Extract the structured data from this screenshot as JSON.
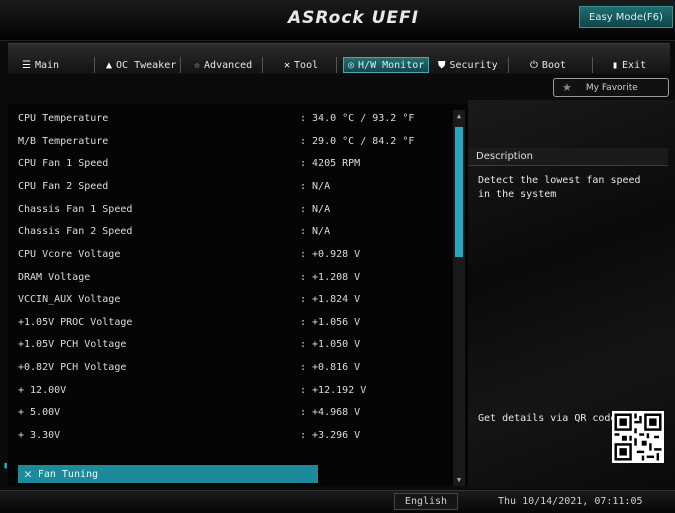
{
  "header": {
    "brand": "ASRock UEFI",
    "easy_mode": "Easy Mode(F6)"
  },
  "tabs": [
    {
      "label": "Main",
      "icon": "list-icon"
    },
    {
      "label": "OC Tweaker",
      "icon": "rocket-icon"
    },
    {
      "label": "Advanced",
      "icon": "star-icon"
    },
    {
      "label": "Tool",
      "icon": "tools-icon"
    },
    {
      "label": "H/W Monitor",
      "icon": "monitor-icon",
      "active": true
    },
    {
      "label": "Security",
      "icon": "shield-icon"
    },
    {
      "label": "Boot",
      "icon": "power-icon"
    },
    {
      "label": "Exit",
      "icon": "exit-icon"
    }
  ],
  "favorite": {
    "label": "My Favorite",
    "icon": "star-icon"
  },
  "monitor": {
    "rows": [
      {
        "label": "CPU Temperature",
        "value": ": 34.0 °C /  93.2 °F"
      },
      {
        "label": "M/B Temperature",
        "value": ": 29.0 °C /  84.2 °F"
      },
      {
        "label": "CPU Fan 1 Speed",
        "value": ": 4205 RPM"
      },
      {
        "label": "CPU Fan 2 Speed",
        "value": ": N/A"
      },
      {
        "label": "Chassis Fan 1 Speed",
        "value": ": N/A"
      },
      {
        "label": "Chassis Fan 2 Speed",
        "value": ": N/A"
      },
      {
        "label": "CPU Vcore Voltage",
        "value": ": +0.928 V"
      },
      {
        "label": "DRAM Voltage",
        "value": ": +1.208 V"
      },
      {
        "label": "VCCIN_AUX Voltage",
        "value": ": +1.824 V"
      },
      {
        "label": "+1.05V PROC Voltage",
        "value": ": +1.056 V"
      },
      {
        "label": "+1.05V PCH Voltage",
        "value": ": +1.050 V"
      },
      {
        "label": "+0.82V PCH Voltage",
        "value": ": +0.816 V"
      },
      {
        "label": "+ 12.00V",
        "value": ": +12.192 V"
      },
      {
        "label": "+ 5.00V",
        "value": ": +4.968 V"
      },
      {
        "label": "+ 3.30V",
        "value": ": +3.296 V"
      }
    ],
    "fan_tuning": "Fan Tuning"
  },
  "description": {
    "header": "Description",
    "text": "Detect the lowest fan speed in the system",
    "qr_text": "Get details via QR code"
  },
  "footer": {
    "language": "English",
    "datetime": "Thu 10/14/2021, 07:11:05"
  },
  "colors": {
    "accent": "#2aa7bd",
    "selection": "#1c8a9a"
  }
}
